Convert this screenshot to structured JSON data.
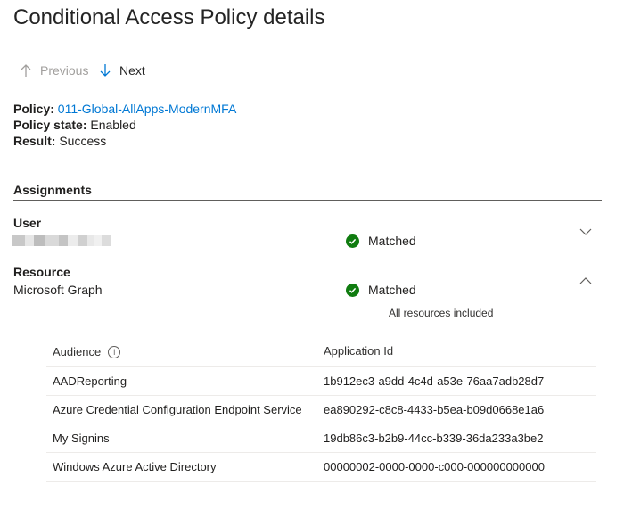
{
  "page": {
    "title": "Conditional Access Policy details"
  },
  "nav": {
    "previous_label": "Previous",
    "next_label": "Next"
  },
  "summary": {
    "policy_label": "Policy:",
    "policy_value": "011-Global-AllApps-ModernMFA",
    "state_label": "Policy state:",
    "state_value": "Enabled",
    "result_label": "Result:",
    "result_value": "Success"
  },
  "assignments": {
    "heading": "Assignments",
    "user": {
      "title": "User",
      "status": "Matched"
    },
    "resource": {
      "title": "Resource",
      "value": "Microsoft Graph",
      "status": "Matched",
      "note": "All resources included"
    }
  },
  "table": {
    "headers": {
      "audience": "Audience",
      "app_id": "Application Id"
    },
    "rows": [
      {
        "audience": "AADReporting",
        "app_id": "1b912ec3-a9dd-4c4d-a53e-76aa7adb28d7"
      },
      {
        "audience": "Azure Credential Configuration Endpoint Service",
        "app_id": "ea890292-c8c8-4433-b5ea-b09d0668e1a6"
      },
      {
        "audience": "My Signins",
        "app_id": "19db86c3-b2b9-44cc-b339-36da233a3be2"
      },
      {
        "audience": "Windows Azure Active Directory",
        "app_id": "00000002-0000-0000-c000-000000000000"
      }
    ]
  },
  "colors": {
    "link": "#0078d4",
    "success": "#107c10",
    "divider": "#e1dfdd"
  },
  "icons": {
    "previous": "arrow-up-icon",
    "next": "arrow-down-icon",
    "status": "checkmark-circle-icon",
    "user_expand": "chevron-down-icon",
    "resource_collapse": "chevron-up-icon",
    "info": "info-icon"
  }
}
